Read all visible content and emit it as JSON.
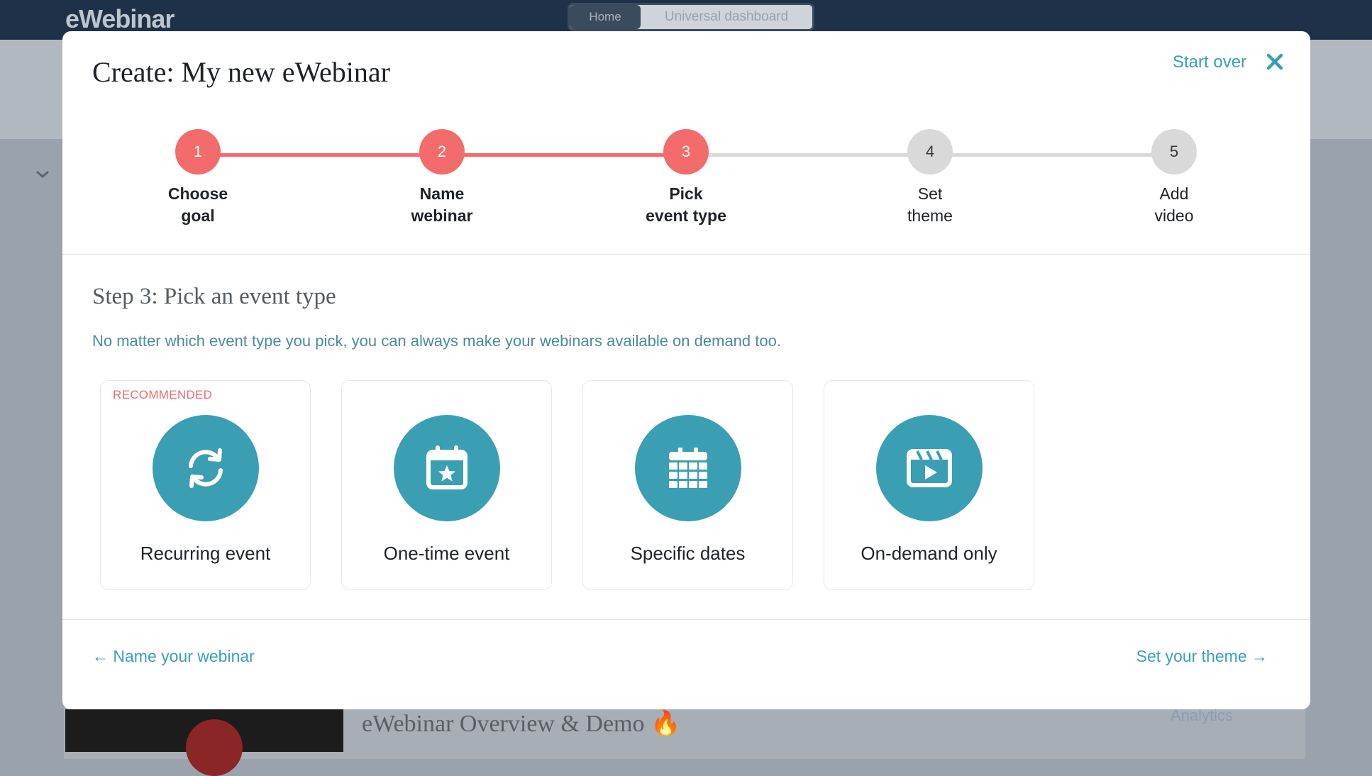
{
  "background": {
    "logo": "eWebinar",
    "toggle": {
      "home": "Home",
      "universal": "Universal dashboard"
    },
    "card_title": "eWebinar Overview & Demo",
    "card_title_emoji": "🔥",
    "analytics": "Analytics"
  },
  "modal": {
    "title": "Create: My new eWebinar",
    "start_over": "Start over",
    "steps": [
      {
        "number": "1",
        "line1": "Choose",
        "line2": "goal",
        "state": "done"
      },
      {
        "number": "2",
        "line1": "Name",
        "line2": "webinar",
        "state": "done"
      },
      {
        "number": "3",
        "line1": "Pick",
        "line2": "event type",
        "state": "current"
      },
      {
        "number": "4",
        "line1": "Set",
        "line2": "theme",
        "state": "todo"
      },
      {
        "number": "5",
        "line1": "Add",
        "line2": "video",
        "state": "todo"
      }
    ],
    "heading": "Step 3:  Pick an event type",
    "subtext": "No matter which event type you pick, you can always make your webinars available on demand too.",
    "options": [
      {
        "label": "Recurring event",
        "badge": "RECOMMENDED",
        "icon": "refresh-icon"
      },
      {
        "label": "One-time event",
        "badge": "",
        "icon": "calendar-star-icon"
      },
      {
        "label": "Specific dates",
        "badge": "",
        "icon": "calendar-grid-icon"
      },
      {
        "label": "On-demand only",
        "badge": "",
        "icon": "video-clapper-icon"
      }
    ],
    "footer": {
      "back": "Name your webinar",
      "next": "Set your theme"
    }
  },
  "colors": {
    "accent": "#3a9fb3",
    "progress": "#f36b6b",
    "inactive": "#d9d9d9"
  }
}
